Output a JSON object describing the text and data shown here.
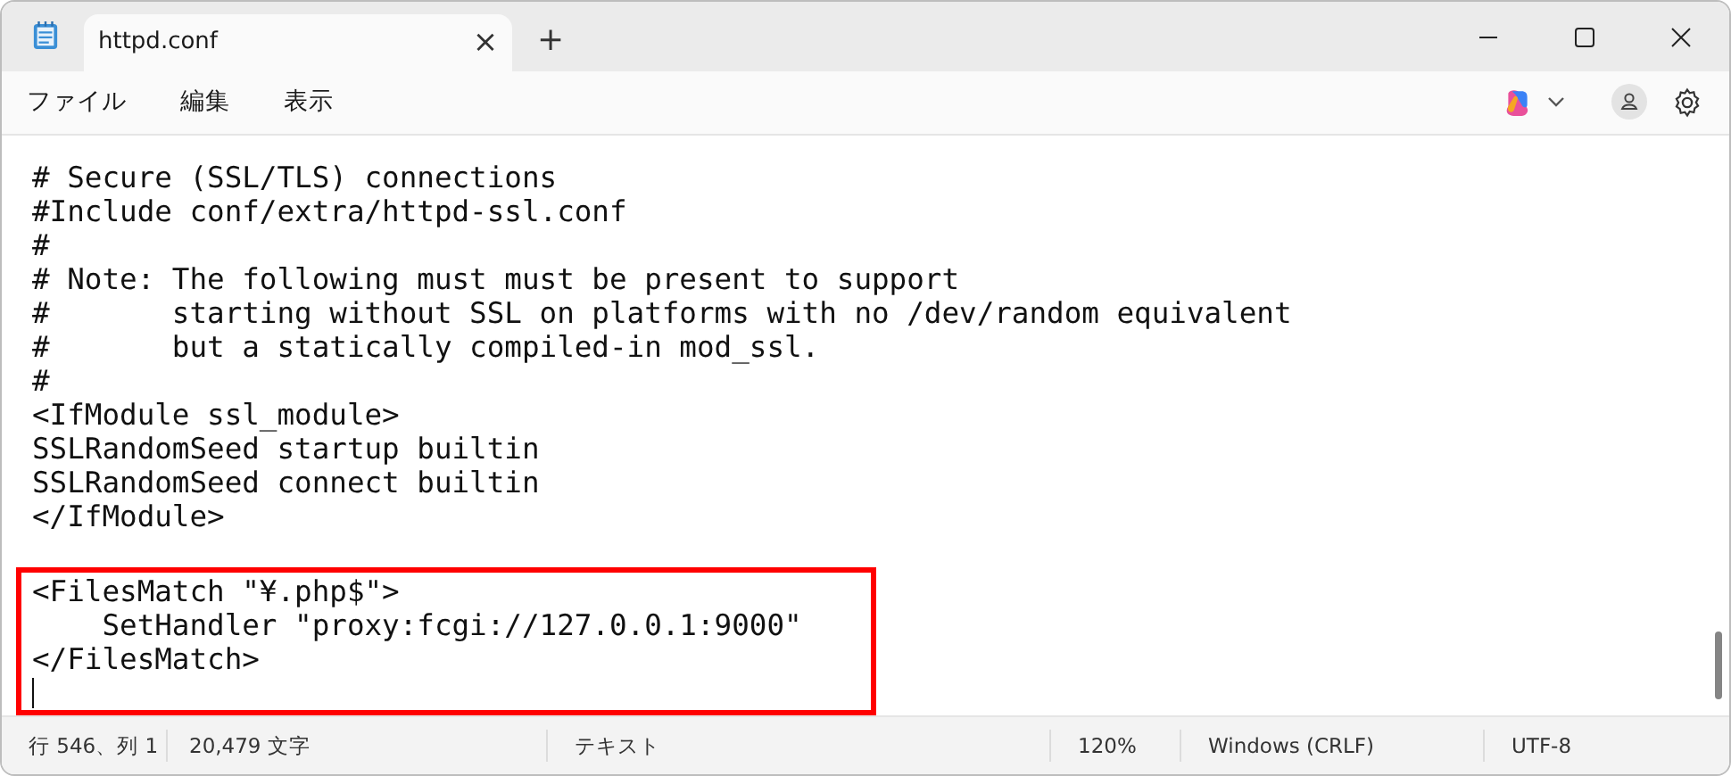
{
  "window": {
    "title": "httpd.conf",
    "tab_close": "×",
    "new_tab": "+"
  },
  "menu": [
    "ファイル",
    "編集",
    "表示"
  ],
  "editor": {
    "lines": [
      {
        "text": "# Secure (SSL/TLS) connections",
        "highlighted": false
      },
      {
        "text": "#Include conf/extra/httpd-ssl.conf",
        "highlighted": false
      },
      {
        "text": "#",
        "highlighted": false
      },
      {
        "text": "# Note: The following must must be present to support",
        "highlighted": false
      },
      {
        "text": "#       starting without SSL on platforms with no /dev/random equivalent",
        "highlighted": false
      },
      {
        "text": "#       but a statically compiled-in mod_ssl.",
        "highlighted": false
      },
      {
        "text": "#",
        "highlighted": false
      },
      {
        "text": "<IfModule ssl_module>",
        "highlighted": false
      },
      {
        "text": "SSLRandomSeed startup builtin",
        "highlighted": false
      },
      {
        "text": "SSLRandomSeed connect builtin",
        "highlighted": false
      },
      {
        "text": "</IfModule>",
        "highlighted": false
      },
      {
        "highlighted": false
      },
      {
        "text": "<FilesMatch \"¥.php$\">",
        "highlighted": true
      },
      {
        "text": "    SetHandler \"proxy:fcgi://127.0.0.1:9000\"",
        "highlighted": true
      },
      {
        "text": "</FilesMatch>",
        "highlighted": true
      },
      {
        "highlighted": true,
        "cursor": true
      }
    ]
  },
  "status_bar": [
    "行 546、列 1",
    "20,479 文字",
    "テキスト",
    "120%",
    "Windows (CRLF)",
    "UTF-8"
  ]
}
